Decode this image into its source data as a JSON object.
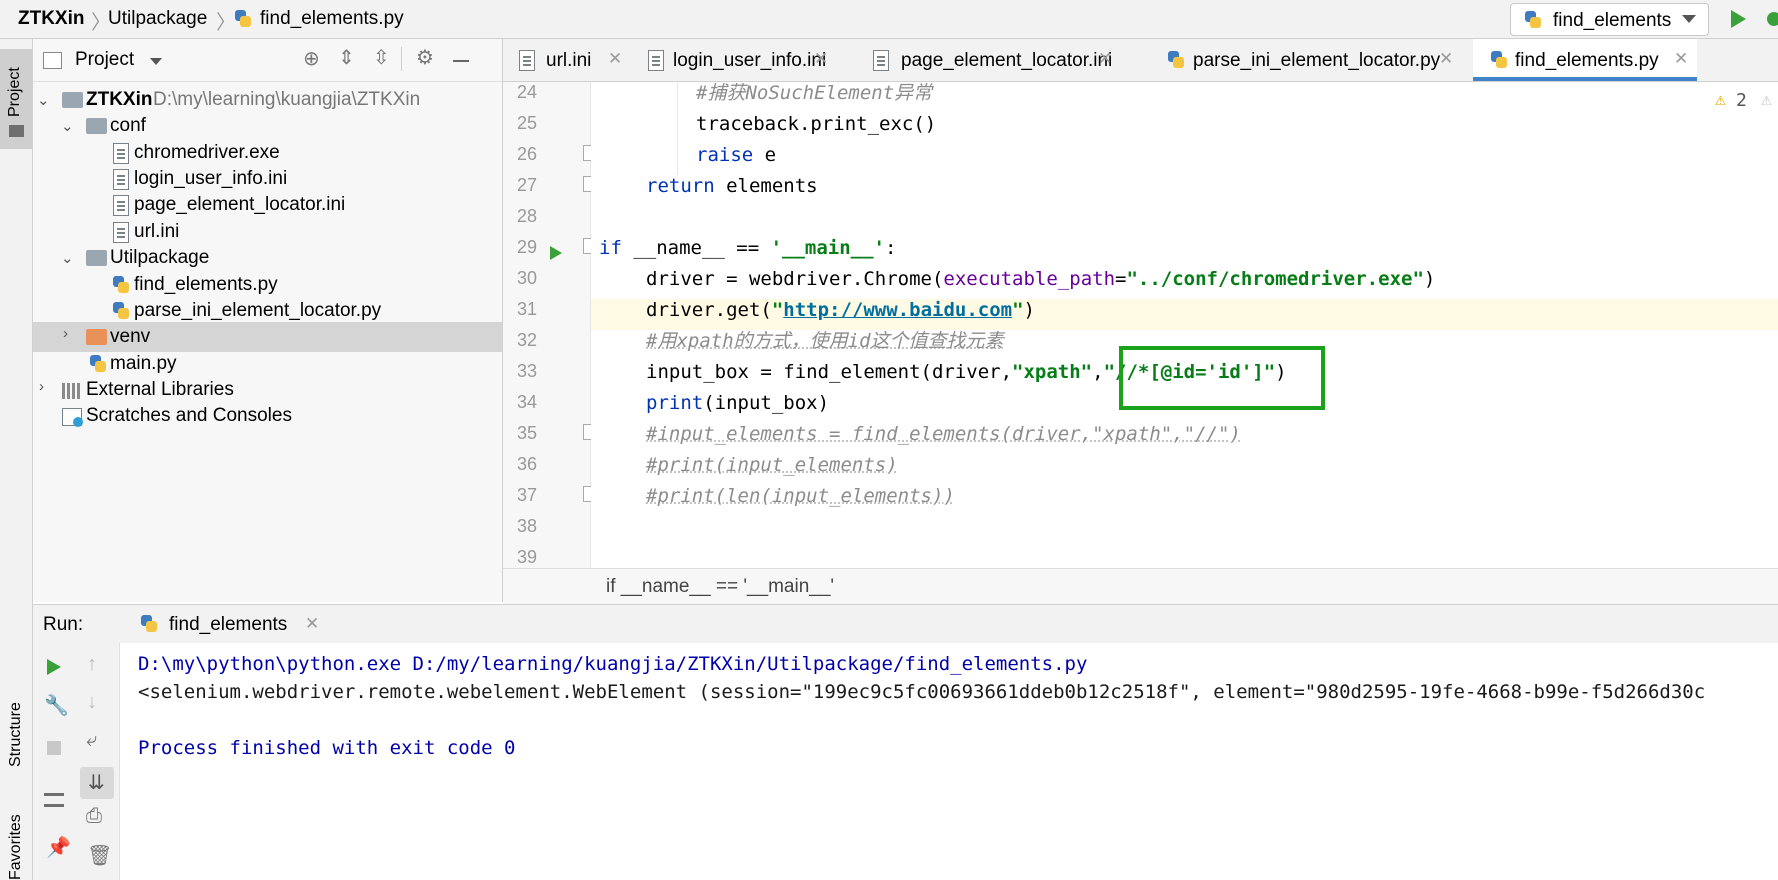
{
  "breadcrumb": {
    "project": "ZTKXin",
    "folder": "Utilpackage",
    "file": "find_elements.py"
  },
  "run_config": {
    "label": "find_elements"
  },
  "left_stripe": {
    "project": "Project",
    "structure": "Structure",
    "favorites": "Favorites"
  },
  "project_panel": {
    "title": "Project",
    "tree": [
      {
        "label": "ZTKXin",
        "path": "D:\\my\\learning\\kuangjia\\ZTKXin"
      },
      {
        "label": "conf"
      },
      {
        "label": "chromedriver.exe"
      },
      {
        "label": "login_user_info.ini"
      },
      {
        "label": "page_element_locator.ini"
      },
      {
        "label": "url.ini"
      },
      {
        "label": "Utilpackage"
      },
      {
        "label": "find_elements.py"
      },
      {
        "label": "parse_ini_element_locator.py"
      },
      {
        "label": "venv"
      },
      {
        "label": "main.py"
      },
      {
        "label": "External Libraries"
      },
      {
        "label": "Scratches and Consoles"
      }
    ]
  },
  "tabs": [
    {
      "label": "url.ini"
    },
    {
      "label": "login_user_info.ini"
    },
    {
      "label": "page_element_locator.ini"
    },
    {
      "label": "parse_ini_element_locator.py"
    },
    {
      "label": "find_elements.py",
      "active": true
    }
  ],
  "editor": {
    "warnings": "2",
    "line_numbers": [
      "24",
      "25",
      "26",
      "27",
      "28",
      "29",
      "30",
      "31",
      "32",
      "33",
      "34",
      "35",
      "36",
      "37",
      "38",
      "39"
    ],
    "code": {
      "l24": "#捕获NoSuchElement异常",
      "l25": "traceback.print_exc()",
      "l26_kw": "raise",
      "l26_rest": " e",
      "l27_kw": "return",
      "l27_rest": " elements",
      "l29_kw": "if",
      "l29_mid": " __name__ == ",
      "l29_str": "'__main__'",
      "l29_end": ":",
      "l30_a": "driver = webdriver.Chrome(",
      "l30_param": "executable_path",
      "l30_eq": "=",
      "l30_str": "\"../conf/chromedriver.exe\"",
      "l30_end": ")",
      "l31_a": "driver.get(",
      "l31_q1": "\"",
      "l31_url": "http://www.baidu.com",
      "l31_q2": "\"",
      "l31_end": ")",
      "l32": "#用xpath的方式，使用id这个值查找元素",
      "l33_a": "input_box = find_element(driver,",
      "l33_s1": "\"xpath\"",
      "l33_comma": ",",
      "l33_s2": "\"//*[@id='id']\"",
      "l33_end": ")",
      "l34_kw": "print",
      "l34_rest": "(input_box)",
      "l35": "#input_elements = find_elements(driver,\"xpath\",\"//\")",
      "l36": "#print(input_elements)",
      "l37": "#print(len(input_elements))"
    },
    "footer_breadcrumb": "if __name__ == '__main__'"
  },
  "run_panel": {
    "label": "Run:",
    "tab": "find_elements",
    "console": [
      "D:\\my\\python\\python.exe D:/my/learning/kuangjia/ZTKXin/Utilpackage/find_elements.py",
      "<selenium.webdriver.remote.webelement.WebElement (session=\"199ec9c5fc00693661ddeb0b12c2518f\", element=\"980d2595-19fe-4668-b99e-f5d266d30c",
      "",
      "Process finished with exit code 0"
    ]
  },
  "colors": {
    "highlight_box": "#1aa31a",
    "tab_underline": "#4083c9",
    "current_line": "#fffae3",
    "selected_row": "#d5d5d5"
  }
}
